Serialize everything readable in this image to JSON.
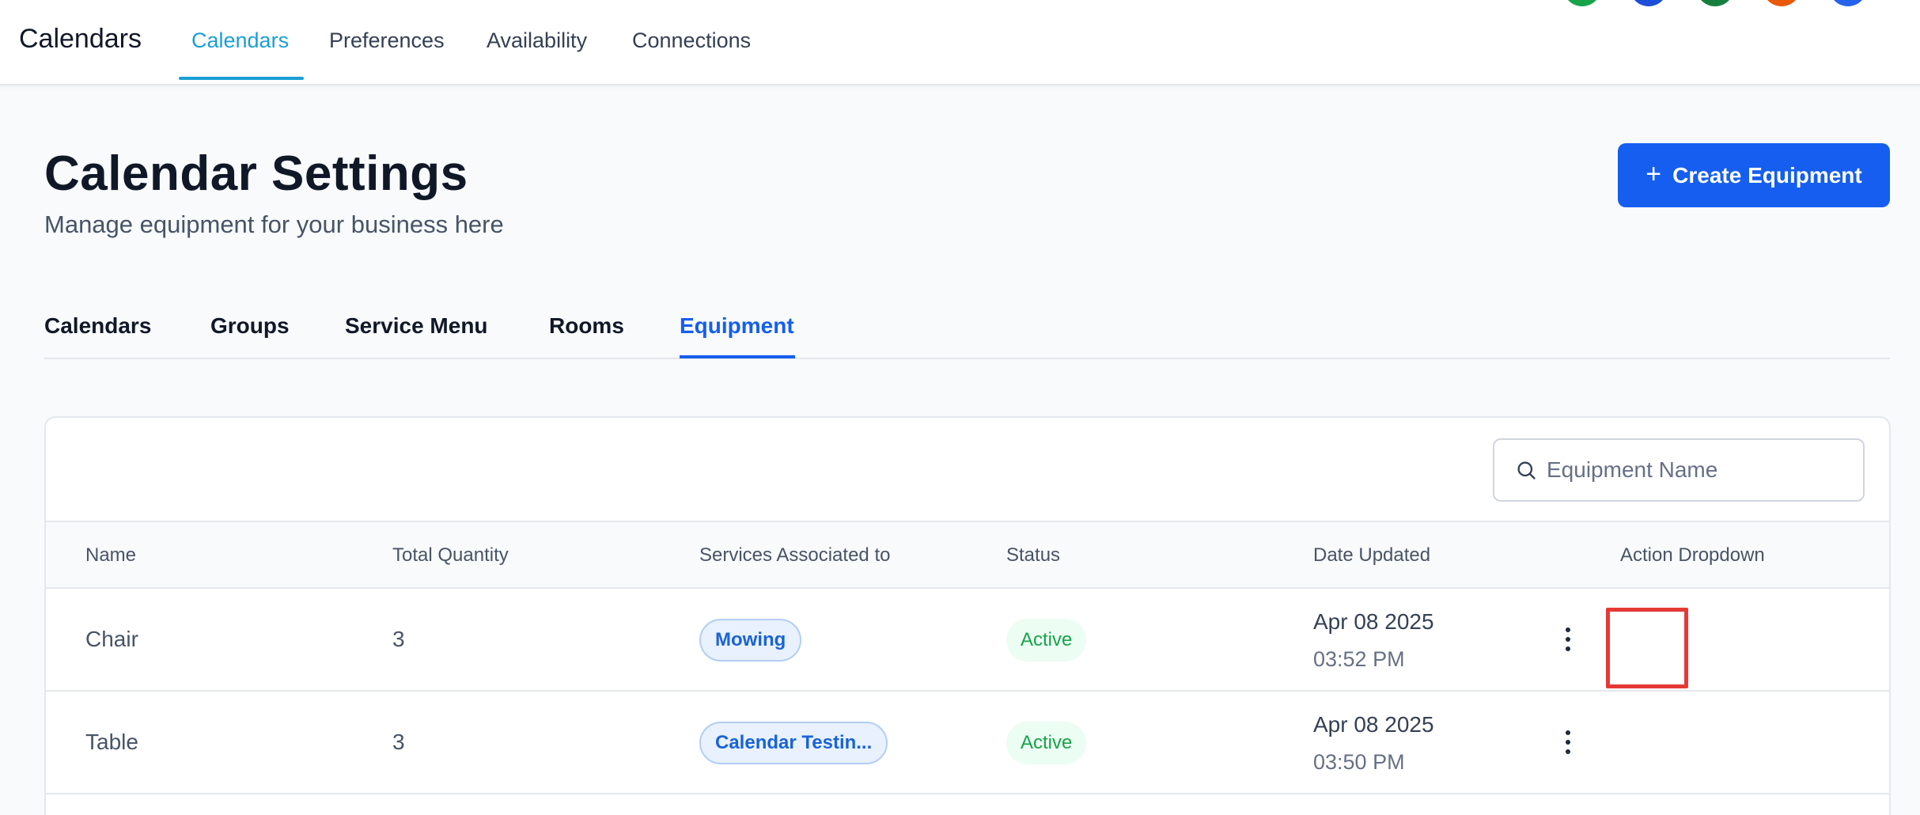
{
  "topbar": {
    "brand": "Calendars",
    "nav": [
      {
        "label": "Calendars",
        "active": true
      },
      {
        "label": "Preferences",
        "active": false
      },
      {
        "label": "Availability",
        "active": false
      },
      {
        "label": "Connections",
        "active": false
      }
    ]
  },
  "header": {
    "title": "Calendar Settings",
    "subtitle": "Manage equipment for your business here",
    "create_label": "Create Equipment",
    "create_icon": "plus-icon"
  },
  "subtabs": [
    {
      "label": "Calendars",
      "active": false
    },
    {
      "label": "Groups",
      "active": false
    },
    {
      "label": "Service Menu",
      "active": false
    },
    {
      "label": "Rooms",
      "active": false
    },
    {
      "label": "Equipment",
      "active": true
    }
  ],
  "search": {
    "placeholder": "Equipment Name",
    "value": ""
  },
  "table": {
    "columns": [
      "Name",
      "Total Quantity",
      "Services Associated to",
      "Status",
      "Date Updated",
      "Action Dropdown"
    ],
    "rows": [
      {
        "name": "Chair",
        "quantity": "3",
        "service": "Mowing",
        "status": "Active",
        "date": "Apr 08 2025",
        "time": "03:52 PM"
      },
      {
        "name": "Table",
        "quantity": "3",
        "service": "Calendar Testin...",
        "status": "Active",
        "date": "Apr 08 2025",
        "time": "03:50 PM"
      }
    ]
  },
  "colors": {
    "primary": "#155eef",
    "topnav_active": "#1b9fd6",
    "status_active": "#16a34a",
    "highlight": "#e53935"
  }
}
